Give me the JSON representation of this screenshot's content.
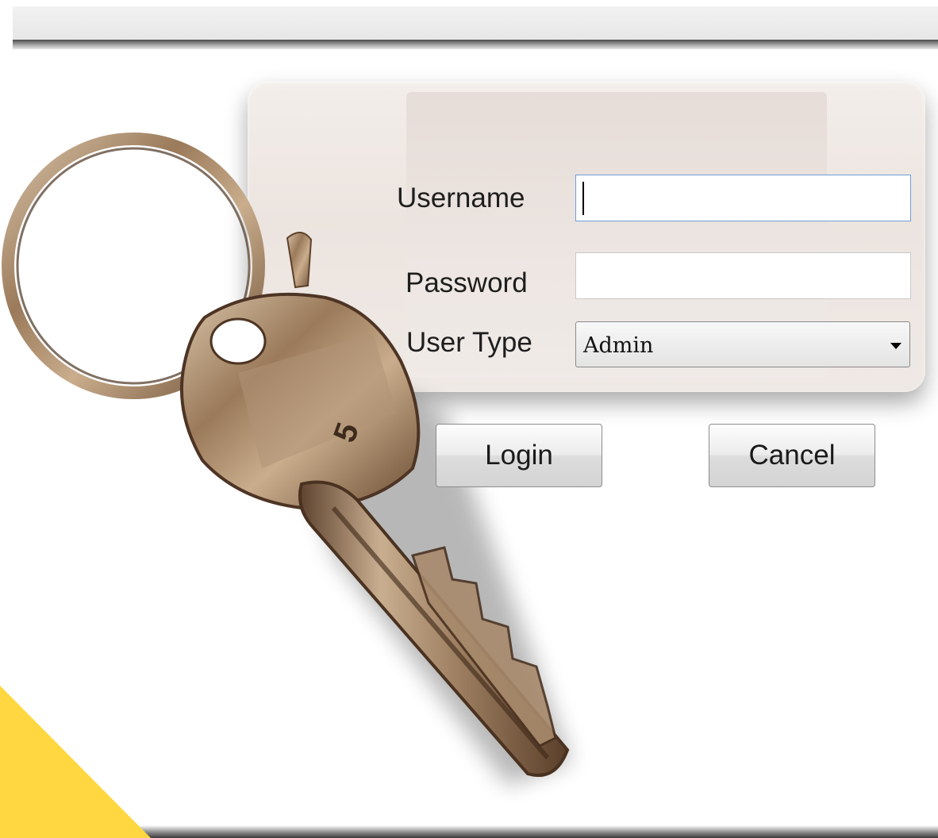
{
  "login_form": {
    "username_label": "Username",
    "username_value": "",
    "password_label": "Password",
    "password_value": "",
    "user_type_label": "User Type",
    "user_type_selected": "Admin"
  },
  "buttons": {
    "login_label": "Login",
    "cancel_label": "Cancel"
  },
  "graphics": {
    "key_number": "5",
    "corner_color": "#ffd740",
    "focus_border_color": "#6f9fd6"
  }
}
